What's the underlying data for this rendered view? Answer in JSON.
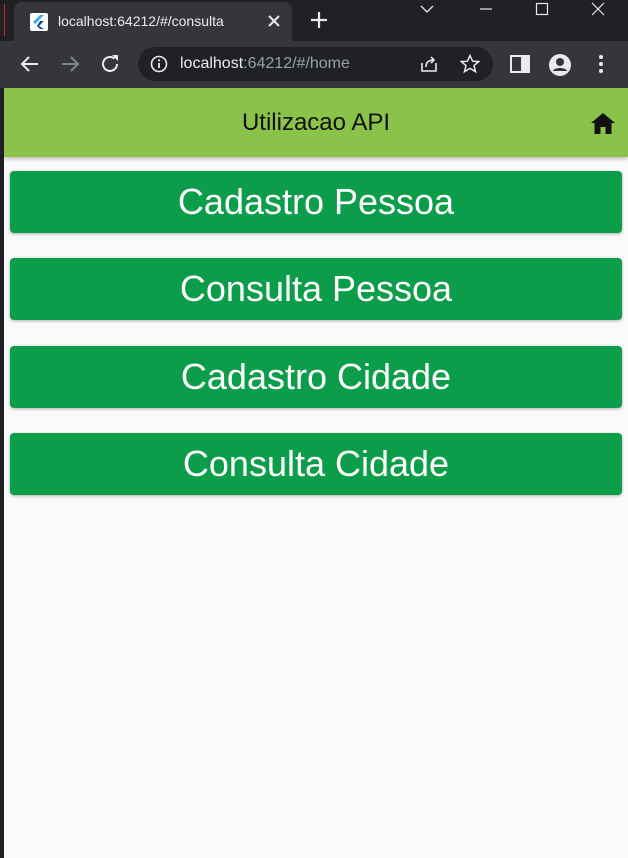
{
  "browser": {
    "tab_title": "localhost:64212/#/consulta",
    "tab_close_icon": "close-icon",
    "new_tab_icon": "plus-icon",
    "url_host": "localhost",
    "url_rest": ":64212/#/home",
    "icons": {
      "back": "arrow-left-icon",
      "forward": "arrow-right-icon",
      "reload": "reload-icon",
      "info": "info-icon",
      "share": "share-icon",
      "bookmark": "star-icon",
      "side_panel": "side-panel-icon",
      "profile": "profile-icon",
      "menu": "more-vert-icon"
    }
  },
  "app": {
    "title": "Utilizacao API",
    "home_icon": "home-icon",
    "colors": {
      "appbar": "#8bc34a",
      "button": "#0c9d4a",
      "background": "#fafafa"
    },
    "buttons": [
      {
        "label": "Cadastro Pessoa"
      },
      {
        "label": "Consulta Pessoa"
      },
      {
        "label": "Cadastro Cidade"
      },
      {
        "label": "Consulta Cidade"
      }
    ]
  }
}
